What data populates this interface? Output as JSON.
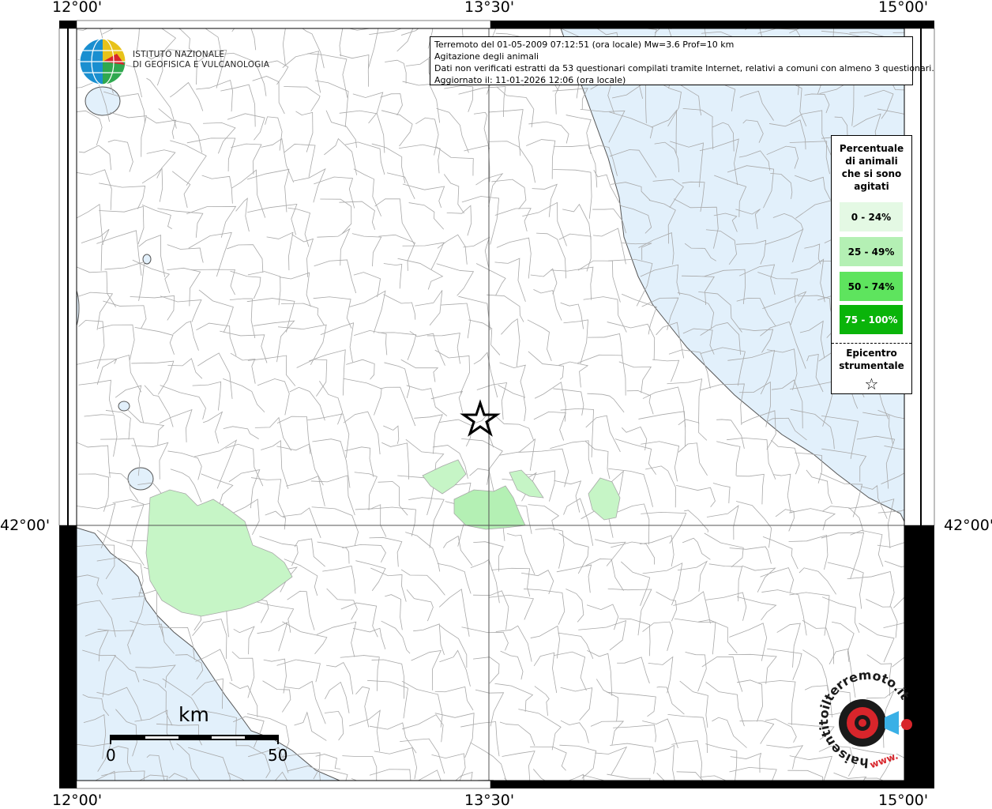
{
  "coordinates": {
    "top": [
      "12°00'",
      "13°30'",
      "15°00'"
    ],
    "bottom": [
      "12°00'",
      "13°30'",
      "15°00'"
    ],
    "left_lat": "42°00'",
    "right_lat": "42°00'"
  },
  "info": {
    "line1": "Terremoto del 01-05-2009 07:12:51 (ora locale) Mw=3.6 Prof=10 km",
    "line2": "Agitazione degli animali",
    "line3": "Dati non verificati estratti da 53 questionari compilati tramite Internet, relativi a comuni con almeno 3 questionari.",
    "line4": "Aggiornato il: 11-01-2026 12:06 (ora locale)"
  },
  "logo": {
    "line1": "ISTITUTO NAZIONALE",
    "line2": "DI GEOFISICA E VULCANOLOGIA"
  },
  "legend": {
    "title_lines": [
      "Percentuale",
      "di animali",
      "che si sono",
      "agitati"
    ],
    "items": [
      {
        "label": "0 - 24%",
        "color": "#e4f9e4",
        "text_color": "#000000"
      },
      {
        "label": "25 - 49%",
        "color": "#b4f0b4",
        "text_color": "#000000"
      },
      {
        "label": "50 - 74%",
        "color": "#5ee45e",
        "text_color": "#000000"
      },
      {
        "label": "75 - 100%",
        "color": "#0ab40a",
        "text_color": "#ffffff"
      }
    ],
    "epicenter_lines": [
      "Epicentro",
      "strumentale"
    ],
    "epicenter_symbol": "☆"
  },
  "scale": {
    "unit": "km",
    "start": "0",
    "end": "50"
  },
  "colors": {
    "sea": "#e2f0fb",
    "land": "#ffffff",
    "borders": "#a8a8a8",
    "affected_light": "#c6f5c6",
    "affected_mid": "#b4f0b4"
  },
  "hst_logo": {
    "text": "haisentitoilterremoto.it",
    "prefix": "www."
  },
  "epicenter_icon": "star-icon"
}
